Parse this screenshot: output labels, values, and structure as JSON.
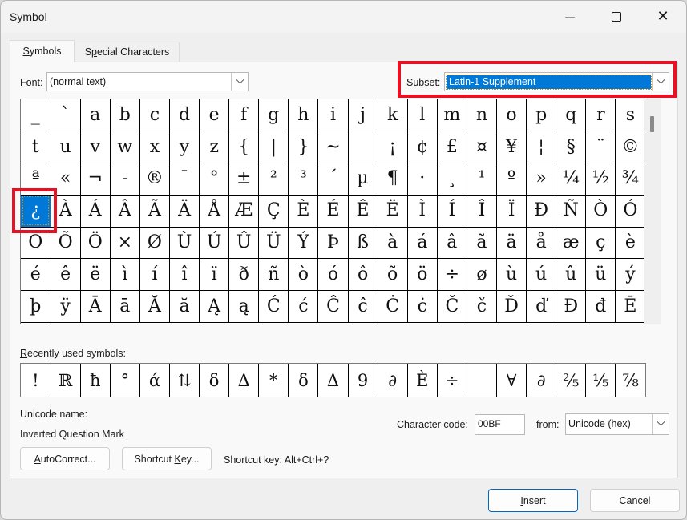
{
  "window": {
    "title": "Symbol",
    "controls": {
      "minimize": "minimize",
      "maximize": "maximize",
      "close": "✕"
    }
  },
  "tabs": [
    {
      "label_prefix": "",
      "mnemonic": "S",
      "label_rest": "ymbols",
      "active": true
    },
    {
      "label_prefix": "S",
      "mnemonic": "p",
      "label_rest": "ecial Characters",
      "active": false
    }
  ],
  "font": {
    "label_mnemonic": "F",
    "label_rest": "ont:",
    "value": "(normal text)"
  },
  "subset": {
    "label_prefix": "S",
    "label_mnemonic": "u",
    "label_rest": "bset:",
    "value": "Latin-1 Supplement"
  },
  "highlight_color": "#e81123",
  "selection_color": "#0078d7",
  "symbol_grid": {
    "rows": [
      [
        "_",
        "`",
        "a",
        "b",
        "c",
        "d",
        "e",
        "f",
        "g",
        "h",
        "i",
        "j",
        "k",
        "l",
        "m",
        "n",
        "o",
        "p",
        "q",
        "r",
        "s"
      ],
      [
        "t",
        "u",
        "v",
        "w",
        "x",
        "y",
        "z",
        "{",
        "|",
        "}",
        "~",
        "",
        "¡",
        "¢",
        "£",
        "¤",
        "¥",
        "¦",
        "§",
        "¨",
        "©"
      ],
      [
        "ª",
        "«",
        "¬",
        "-",
        "®",
        "¯",
        "°",
        "±",
        "²",
        "³",
        "´",
        "µ",
        "¶",
        "·",
        "¸",
        "¹",
        "º",
        "»",
        "¼",
        "½",
        "¾"
      ],
      [
        "¿",
        "À",
        "Á",
        "Â",
        "Ã",
        "Ä",
        "Å",
        "Æ",
        "Ç",
        "È",
        "É",
        "Ê",
        "Ë",
        "Ì",
        "Í",
        "Î",
        "Ï",
        "Ð",
        "Ñ",
        "Ò",
        "Ó"
      ],
      [
        "Ô",
        "Õ",
        "Ö",
        "×",
        "Ø",
        "Ù",
        "Ú",
        "Û",
        "Ü",
        "Ý",
        "Þ",
        "ß",
        "à",
        "á",
        "â",
        "ã",
        "ä",
        "å",
        "æ",
        "ç",
        "è"
      ],
      [
        "é",
        "ê",
        "ë",
        "ì",
        "í",
        "î",
        "ï",
        "ð",
        "ñ",
        "ò",
        "ó",
        "ô",
        "õ",
        "ö",
        "÷",
        "ø",
        "ù",
        "ú",
        "û",
        "ü",
        "ý"
      ],
      [
        "þ",
        "ÿ",
        "Ā",
        "ā",
        "Ă",
        "ă",
        "Ą",
        "ą",
        "Ć",
        "ć",
        "Ĉ",
        "ĉ",
        "Ċ",
        "ċ",
        "Č",
        "č",
        "Ď",
        "ď",
        "Đ",
        "đ",
        "Ē"
      ]
    ],
    "selected": {
      "row": 3,
      "col": 0
    }
  },
  "recent": {
    "label_mnemonic": "R",
    "label_rest": "ecently used symbols:",
    "symbols": [
      "!",
      "ℝ",
      "ħ",
      "°",
      "ά",
      "⇅",
      "δ",
      "Δ",
      "*",
      "δ",
      "Δ",
      "9",
      "∂",
      "È",
      "÷",
      "",
      "∀",
      "∂",
      "⅖",
      "⅕",
      "⅞"
    ]
  },
  "unicode_name": {
    "label": "Unicode name:",
    "value": "Inverted Question Mark"
  },
  "character_code": {
    "label_mnemonic": "C",
    "label_rest": "haracter code:",
    "value": "00BF"
  },
  "from": {
    "label_prefix": "fro",
    "label_mnemonic": "m",
    "label_rest": ":",
    "value": "Unicode (hex)"
  },
  "buttons": {
    "autocorrect": {
      "mnemonic": "A",
      "rest": "utoCorrect..."
    },
    "shortcut_key": {
      "prefix": "Shortcut ",
      "mnemonic": "K",
      "rest": "ey..."
    },
    "insert": {
      "mnemonic": "I",
      "rest": "nsert"
    },
    "cancel": {
      "label": "Cancel"
    }
  },
  "shortcut_key_text": "Shortcut key: Alt+Ctrl+?"
}
